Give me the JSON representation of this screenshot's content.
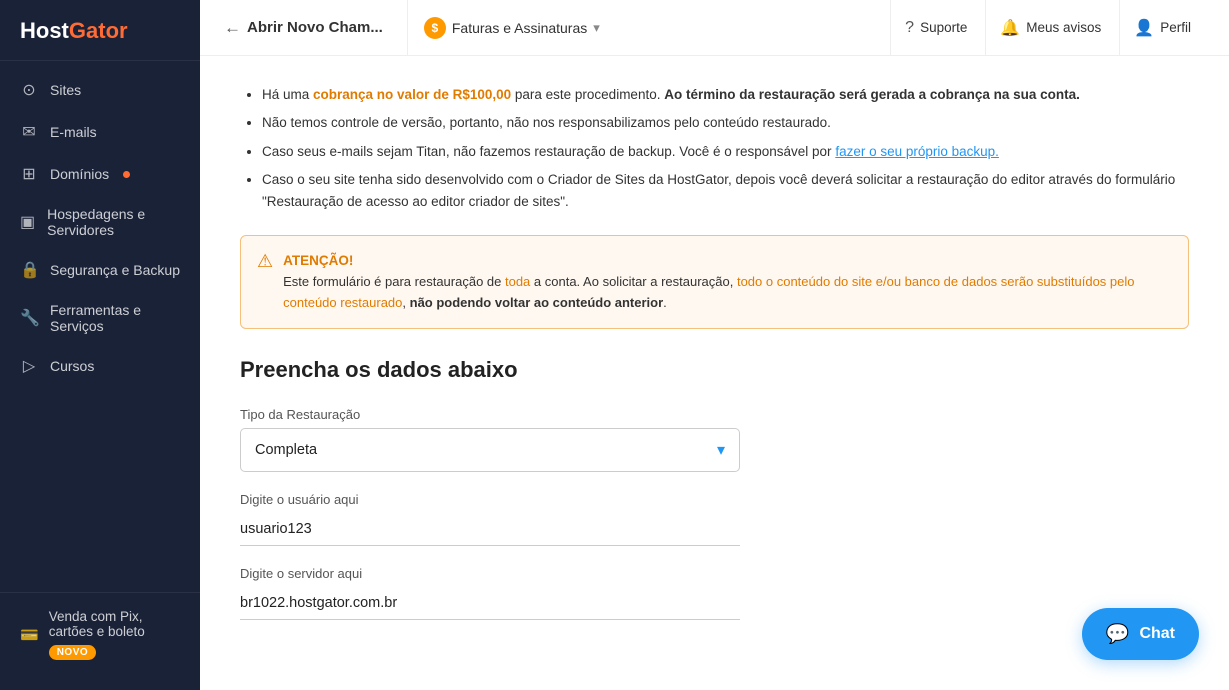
{
  "logo": {
    "text": "HostGator"
  },
  "sidebar": {
    "items": [
      {
        "id": "sites",
        "label": "Sites",
        "icon": "⊙"
      },
      {
        "id": "emails",
        "label": "E-mails",
        "icon": "✉"
      },
      {
        "id": "dominios",
        "label": "Domínios",
        "icon": "⊞",
        "badge_dot": true
      },
      {
        "id": "hospedagens",
        "label": "Hospedagens e Servidores",
        "icon": "▣"
      },
      {
        "id": "seguranca",
        "label": "Segurança e Backup",
        "icon": "🔒"
      },
      {
        "id": "ferramentas",
        "label": "Ferramentas e Serviços",
        "icon": "🔧"
      },
      {
        "id": "cursos",
        "label": "Cursos",
        "icon": "▷"
      }
    ],
    "bottom_item": {
      "label": "Venda com Pix, cartões e boleto",
      "icon": "💳",
      "badge": "NOVO"
    }
  },
  "topbar": {
    "back_label": "Abrir Novo Cham...",
    "back_arrow": "←",
    "section_label": "Faturas e Assinaturas",
    "section_chevron": "▾",
    "suporte_label": "Suporte",
    "avisos_label": "Meus avisos",
    "perfil_label": "Perfil"
  },
  "content": {
    "bullets": [
      {
        "id": "bullet1",
        "text_parts": [
          {
            "type": "normal",
            "text": "Há uma "
          },
          {
            "type": "orange-bold",
            "text": "cobrança no valor de R$100,00"
          },
          {
            "type": "normal",
            "text": " para este procedimento. "
          },
          {
            "type": "bold",
            "text": "Ao término da restauração será gerada a cobrança na sua conta."
          }
        ]
      },
      {
        "id": "bullet2",
        "text": "Não temos controle de versão, portanto, não nos responsabilizamos pelo conteúdo restaurado."
      },
      {
        "id": "bullet3",
        "text_parts": [
          {
            "type": "normal",
            "text": "Caso seus e-mails sejam Titan, não fazemos restauração de backup. Você é o responsável por "
          },
          {
            "type": "link",
            "text": "fazer o seu próprio backup."
          }
        ]
      },
      {
        "id": "bullet4",
        "text_parts": [
          {
            "type": "normal",
            "text": "Caso o seu site tenha sido desenvolvido com o Criador de Sites da HostGator, depois você deverá solicitar a restauração do editor através do formulário \"Restauração de acesso ao editor criador de sites\"."
          }
        ]
      }
    ],
    "atencao": {
      "title": "ATENÇÃO!",
      "text1": "Este formulário é para restauração de ",
      "highlight1": "toda",
      "text2": " a conta. Ao solicitar a restauração, ",
      "highlight2": "todo o conteúdo do site e/ou banco de dados serão substituídos pelo conteúdo restaurado",
      "text3": ", ",
      "highlight3": "não podendo voltar ao conteúdo anterior",
      "text4": "."
    },
    "section_title": "Preencha os dados abaixo",
    "fields": {
      "tipo_restauracao": {
        "label": "Tipo da Restauração",
        "value": "Completa",
        "chevron": "▾"
      },
      "usuario": {
        "label": "Digite o usuário aqui",
        "value": "usuario123"
      },
      "servidor": {
        "label": "Digite o servidor aqui",
        "value": "br1022.hostgator.com.br"
      }
    }
  },
  "chat_button": {
    "label": "Chat",
    "icon": "💬"
  }
}
